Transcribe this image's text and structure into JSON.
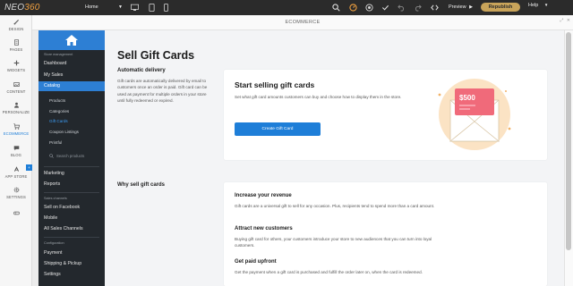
{
  "topbar": {
    "logo_main": "NEO",
    "logo_accent": "360",
    "page_select": "Home",
    "preview_label": "Preview",
    "republish_label": "Republish",
    "help_label": "Help"
  },
  "rail": {
    "items": [
      {
        "label": "DESIGN",
        "icon": "brush-icon"
      },
      {
        "label": "PAGES",
        "icon": "pages-icon"
      },
      {
        "label": "WIDGETS",
        "icon": "plus-icon"
      },
      {
        "label": "CONTENT",
        "icon": "content-icon"
      },
      {
        "label": "PERSONALIZE",
        "icon": "person-icon"
      },
      {
        "label": "ECOMMERCE",
        "icon": "cart-icon",
        "active": true
      },
      {
        "label": "BLOG",
        "icon": "chat-icon"
      },
      {
        "label": "APP STORE",
        "icon": "apps-icon"
      },
      {
        "label": "SETTINGS",
        "icon": "gear-icon"
      }
    ],
    "badge": "+"
  },
  "header": {
    "title": "ECOMMERCE"
  },
  "store_nav": {
    "label_store": "Store management",
    "dashboard": "Dashboard",
    "my_sales": "My Sales",
    "catalog": "Catalog",
    "products": "Products",
    "categories": "Categories",
    "gift_cards": "Gift Cards",
    "coupons": "Coupon Listings",
    "printful": "Printful",
    "search_placeholder": "Search products",
    "marketing": "Marketing",
    "reports": "Reports",
    "label_channels": "Sales channels",
    "facebook": "Sell on Facebook",
    "mobile": "Mobile",
    "all_channels": "All Sales Channels",
    "label_config": "Configuration",
    "payment": "Payment",
    "shipping": "Shipping & Pickup",
    "settings": "Settings"
  },
  "main": {
    "title": "Sell Gift Cards",
    "auto_delivery_heading": "Automatic delivery",
    "auto_delivery_text": "Gift cards are automatically delivered by email to customers once an order is paid. Gift card can be used as payment for multiple orders in your store until fully redeemed or expired.",
    "start_card": {
      "title": "Start selling gift cards",
      "text": "Set what gift card amounts customers can buy and choose how to display them in the store.",
      "button": "Create Gift Card",
      "illus_amount": "$500"
    },
    "why_heading": "Why sell gift cards",
    "features": [
      {
        "heading": "Increase your revenue",
        "text": "Gift cards are a universal gift to sell for any occasion. Plus, recipients tend to spend more than a card amount."
      },
      {
        "heading": "Attract new customers",
        "text": "Buying gift card for others, your customers introduce your store to new audiences that you can turn into loyal customers."
      },
      {
        "heading": "Get paid upfront",
        "text": "Get the payment when a gift card is purchased and fulfill the order later on, when the card is redeemed."
      }
    ]
  },
  "colors": {
    "accent": "#1e7ed8",
    "republish": "#c9a45a",
    "sidebar_bg": "#23282d",
    "illustration_bg": "#fbe3c4",
    "card_pink": "#f06a7a"
  }
}
